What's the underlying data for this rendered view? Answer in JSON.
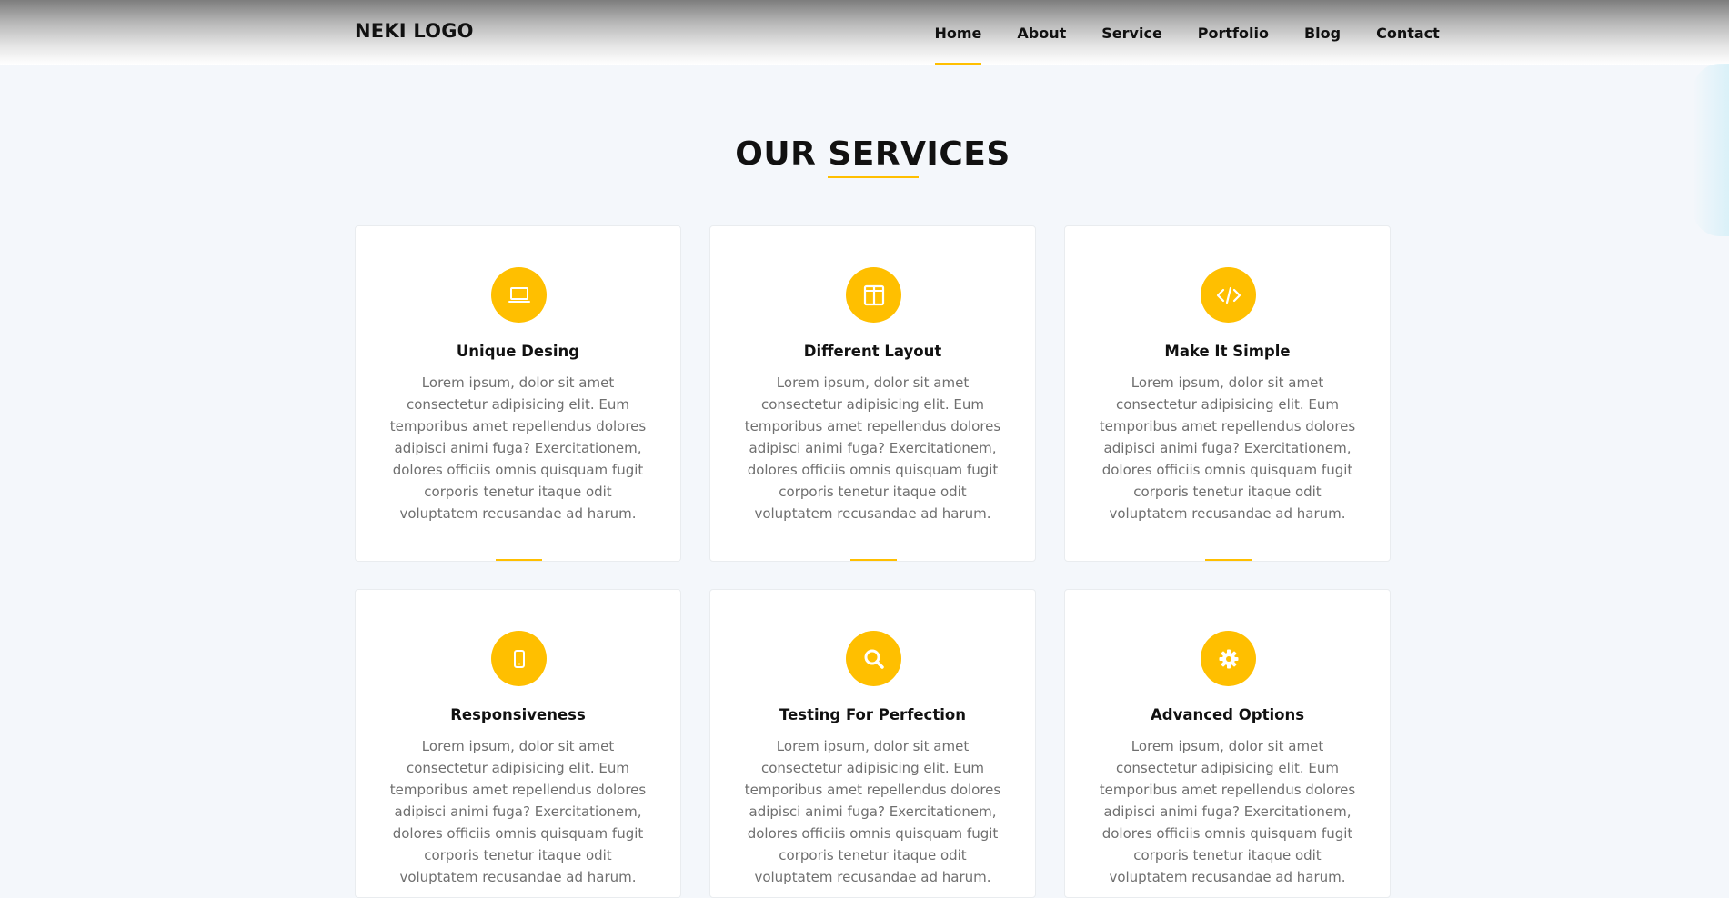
{
  "nav": {
    "logo": "NEKI LOGO",
    "links": [
      "Home",
      "About",
      "Service",
      "Portfolio",
      "Blog",
      "Contact"
    ],
    "active": "Home"
  },
  "section": {
    "title": "OUR SERVICES"
  },
  "services": [
    {
      "icon": "laptop-icon",
      "title": "Unique Desing",
      "text": "Lorem ipsum, dolor sit amet consectetur adipisicing elit. Eum temporibus amet repellendus dolores adipisci animi fuga? Exercitationem, dolores officiis omnis quisquam fugit corporis tenetur itaque odit voluptatem recusandae ad harum."
    },
    {
      "icon": "columns-icon",
      "title": "Different Layout",
      "text": "Lorem ipsum, dolor sit amet consectetur adipisicing elit. Eum temporibus amet repellendus dolores adipisci animi fuga? Exercitationem, dolores officiis omnis quisquam fugit corporis tenetur itaque odit voluptatem recusandae ad harum."
    },
    {
      "icon": "code-icon",
      "title": "Make It Simple",
      "text": "Lorem ipsum, dolor sit amet consectetur adipisicing elit. Eum temporibus amet repellendus dolores adipisci animi fuga? Exercitationem, dolores officiis omnis quisquam fugit corporis tenetur itaque odit voluptatem recusandae ad harum."
    },
    {
      "icon": "mobile-icon",
      "title": "Responsiveness",
      "text": "Lorem ipsum, dolor sit amet consectetur adipisicing elit. Eum temporibus amet repellendus dolores adipisci animi fuga? Exercitationem, dolores officiis omnis quisquam fugit corporis tenetur itaque odit voluptatem recusandae ad harum."
    },
    {
      "icon": "search-icon",
      "title": "Testing For Perfection",
      "text": "Lorem ipsum, dolor sit amet consectetur adipisicing elit. Eum temporibus amet repellendus dolores adipisci animi fuga? Exercitationem, dolores officiis omnis quisquam fugit corporis tenetur itaque odit voluptatem recusandae ad harum."
    },
    {
      "icon": "gear-icon",
      "title": "Advanced Options",
      "text": "Lorem ipsum, dolor sit amet consectetur adipisicing elit. Eum temporibus amet repellendus dolores adipisci animi fuga? Exercitationem, dolores officiis omnis quisquam fugit corporis tenetur itaque odit voluptatem recusandae ad harum."
    }
  ],
  "colors": {
    "accent": "#ffbf00",
    "page_background": "#f4f7fb",
    "body_text": "#6f6f6f"
  }
}
